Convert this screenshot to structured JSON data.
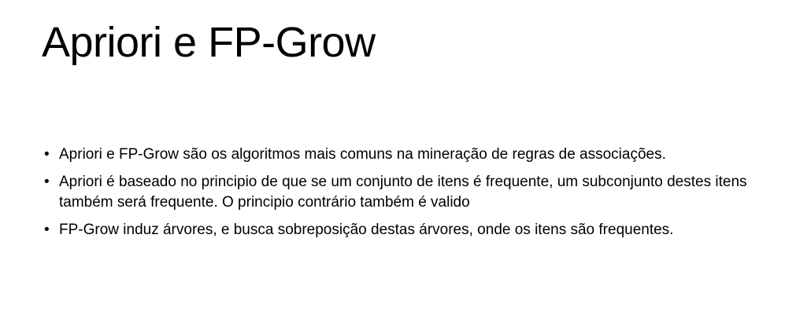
{
  "slide": {
    "title": "Apriori e FP-Grow",
    "bullet_glyph": "•",
    "bullets": [
      {
        "text": "Apriori e FP-Grow são os algoritmos mais comuns na mineração de regras de associações."
      },
      {
        "text": "Apriori é baseado no principio de que se um conjunto de itens é frequente, um subconjunto destes itens também será frequente. O principio contrário também é valido"
      },
      {
        "text": "FP-Grow induz árvores, e busca sobreposição destas árvores, onde os itens são frequentes."
      }
    ]
  }
}
